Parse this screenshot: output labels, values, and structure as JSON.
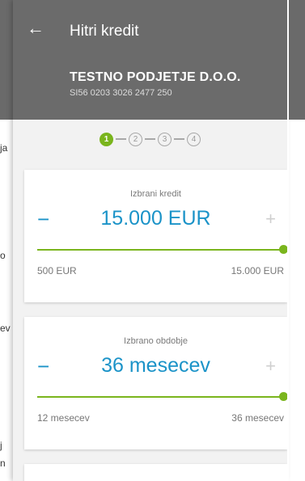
{
  "background": {
    "snippets": [
      "ja",
      "o",
      "ev",
      "j",
      "n"
    ]
  },
  "appbar": {
    "title": "Hitri kredit",
    "company_name": "TESTNO PODJETJE D.O.O.",
    "iban": "SI56 0203 3026 2477 250"
  },
  "stepper": {
    "steps": [
      "1",
      "2",
      "3",
      "4"
    ],
    "active_step": 1
  },
  "credit_card": {
    "label": "Izbrani kredit",
    "value": "15.000 EUR",
    "minus_label": "−",
    "plus_label": "+",
    "min_label": "500 EUR",
    "max_label": "15.000 EUR",
    "slider_fraction": 1.0
  },
  "period_card": {
    "label": "Izbrano obdobje",
    "value": "36 mesecev",
    "minus_label": "−",
    "plus_label": "+",
    "min_label": "12 mesecev",
    "max_label": "36 mesecev",
    "slider_fraction": 1.0
  },
  "colors": {
    "accent_blue": "#1b93c8",
    "accent_green": "#7ab51d",
    "appbar": "#6b6b6b"
  }
}
